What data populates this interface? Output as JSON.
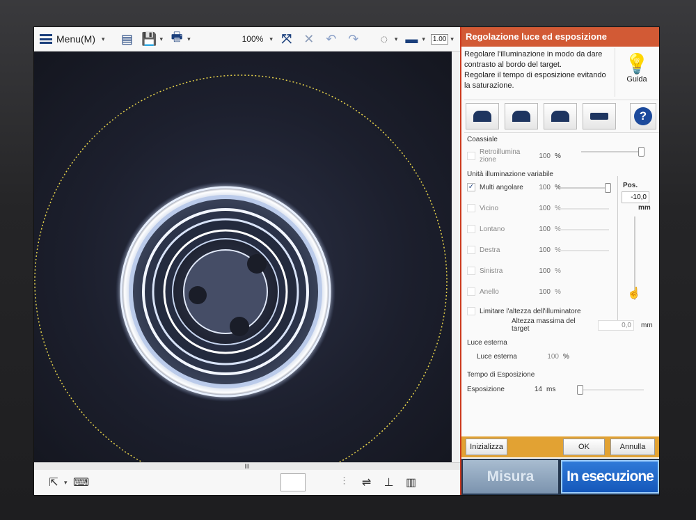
{
  "toolbar": {
    "menu_label": "Menu(M)",
    "zoom": "100%",
    "ratio": "1.00"
  },
  "panel": {
    "title": "Regolazione luce ed esposizione",
    "instructions": [
      "Regolare l'illuminazione in modo da dare",
      "contrasto al bordo del target.",
      "Regolare il tempo di esposizione evitando",
      "la saturazione."
    ],
    "guide_label": "Guida",
    "coaxial": {
      "section": "Coassiale",
      "label_line1": "Retroillumina",
      "label_line2": "zione",
      "value": "100",
      "unit": "%"
    },
    "variable": {
      "section": "Unità illuminazione variabile",
      "pos_label": "Pos.",
      "pos_value": "-10,0",
      "pos_unit": "mm",
      "items": [
        {
          "label": "Multi angolare",
          "value": "100",
          "unit": "%",
          "checked": true
        },
        {
          "label": "Vicino",
          "value": "100",
          "unit": "%",
          "checked": false
        },
        {
          "label": "Lontano",
          "value": "100",
          "unit": "%",
          "checked": false
        },
        {
          "label": "Destra",
          "value": "100",
          "unit": "%",
          "checked": false
        },
        {
          "label": "Sinistra",
          "value": "100",
          "unit": "%",
          "checked": false
        },
        {
          "label": "Anello",
          "value": "100",
          "unit": "%",
          "checked": false
        }
      ]
    },
    "limit_label": "Limitare l'altezza dell'illuminatore",
    "max_height_label": "Altezza massima del target",
    "max_height_value": "0,0",
    "max_height_unit": "mm",
    "external": {
      "section": "Luce esterna",
      "label": "Luce esterna",
      "value": "100",
      "unit": "%"
    },
    "exposure": {
      "section": "Tempo di Esposizione",
      "label": "Esposizione",
      "value": "14",
      "unit": "ms"
    },
    "buttons": {
      "init": "Inizializza",
      "ok": "OK",
      "cancel": "Annulla"
    },
    "big_buttons": {
      "measure": "Misura",
      "running": "In esecuzione"
    }
  },
  "scroll_marker": "III"
}
